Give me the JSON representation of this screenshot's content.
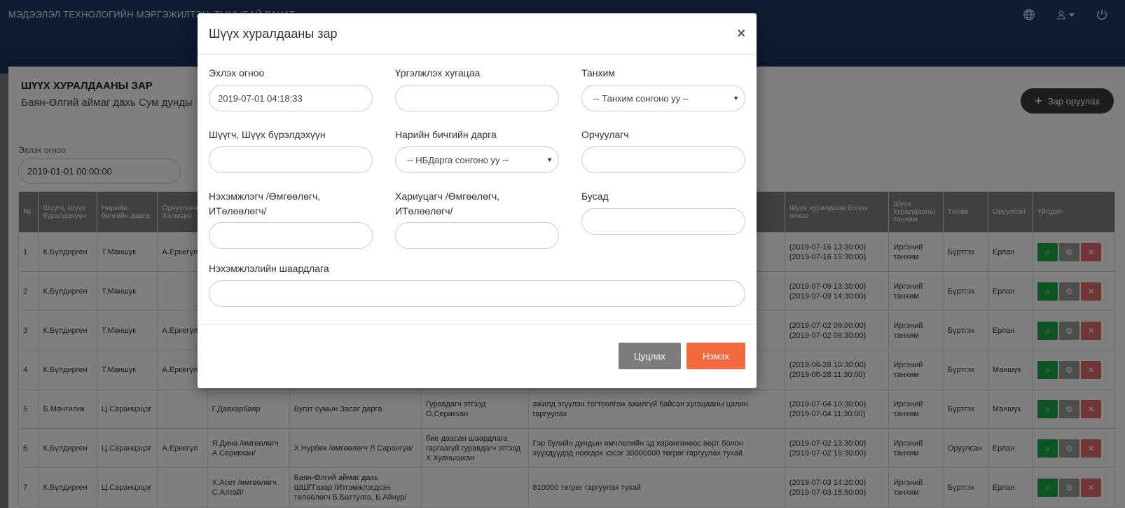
{
  "header": {
    "brand": "МЭДЭЭЛЭЛ ТЕХНОЛОГИЙН МЭРГЭЖИЛТЭН, ТЫНЫБАЙ ВАНАТ",
    "icons": [
      "globe-icon",
      "user-icon",
      "power-icon"
    ]
  },
  "page": {
    "title": "ШҮҮХ ХУРАЛДААНЫ ЗАР",
    "subtitle": "Баян-Өлгий аймаг дахь Сум дунды",
    "add_button": "Зар оруулах",
    "filter_label": "Эхлэх огноо",
    "filter_value": "2019-01-01 00:00:00"
  },
  "table": {
    "headers": [
      "№",
      "Шүүгч, Шүүх бүрэлдэхүүн",
      "Нарийн бичгийн дарга",
      "Орчуулагч Хэлмэрч",
      "",
      "",
      "",
      "",
      "Шүүх хуралдаан болох огноо",
      "Шүүх хуралдааны танхим",
      "Төлөв",
      "Оруулсан",
      "Үйлдэл"
    ],
    "rows": [
      {
        "no": "1",
        "judge": "К.Бүлдирген",
        "secretary": "Т.Маншук",
        "translator": "А.Еркегүл",
        "plaintiff": "",
        "defendant": "",
        "third": "",
        "claim": "",
        "date1": "(2019-07-16 13:30:00)",
        "date2": "(2019-07-16 15:30:00)",
        "hall": "Иргэний танхим",
        "status": "Бүртгэх",
        "added": "Ерлан"
      },
      {
        "no": "2",
        "judge": "К.Бүлдирген",
        "secretary": "Т.Маншук",
        "translator": "",
        "plaintiff": "",
        "defendant": "",
        "third": "",
        "claim": "",
        "date1": "(2019-07-09 13:30:00)",
        "date2": "(2019-07-09 14:30:00)",
        "hall": "Иргэний танхим",
        "status": "Бүртгэх",
        "added": "Ерлан"
      },
      {
        "no": "3",
        "judge": "К.Бүлдирген",
        "secretary": "Т.Маншук",
        "translator": "А.Еркегүл",
        "plaintiff": "",
        "defendant": "",
        "third": "",
        "claim": "",
        "date1": "(2019-07-02 09:00:00)",
        "date2": "(2019-07-02 09:30:00)",
        "hall": "Иргэний танхим",
        "status": "Бүртгэх",
        "added": "Ерлан"
      },
      {
        "no": "4",
        "judge": "К.Бүлдирген",
        "secretary": "Т.Маншук",
        "translator": "А.Еркегүл",
        "plaintiff": "",
        "defendant": "",
        "third": "",
        "claim": "",
        "date1": "(2019-06-28 10:30:00)",
        "date2": "(2019-06-28 11:30:00)",
        "hall": "Иргэний танхим",
        "status": "Бүртгэх",
        "added": "Маншук"
      },
      {
        "no": "5",
        "judge": "Б.Мангилик",
        "secretary": "Ц.Саранцэцэг",
        "translator": "",
        "plaintiff": "Г.Давхарбаяр",
        "defendant": "Бугат сумын Засаг дарга",
        "third": "Гуравдагч этгээд О.Серикхан",
        "claim": "ажилд эгүүлэн тогтоолгож ажилгүй байсан хугацааны цалин гаргуулах",
        "date1": "(2019-07-04 10:30:00)",
        "date2": "(2019-07-04 11:30:00)",
        "hall": "Иргэний танхим",
        "status": "Бүртгэх",
        "added": "Маншук"
      },
      {
        "no": "6",
        "judge": "К.Бүлдирген",
        "secretary": "Ц.Саранцэцэг",
        "translator": "А.Еркегүл",
        "plaintiff": "Я.Дина /өмгөөлөгч А.Серикхан/",
        "defendant": "Х.Нурбек /өмгөөлөгч Л.Сарангуа/",
        "third": "бие даасан шаардлага гаргаагүй гуравдагч этгээд Х.Хуанышхан",
        "claim": "Гэр бүлийн дундын өмчлөлийн эд хөрөнгөнөөс өөрт болон хүүхдүүдэд ноогдох хэсэг 35000000 төгрөг гаргуулах тухай",
        "date1": "(2019-07-02 13:30:00)",
        "date2": "(2019-07-02 15:30:00)",
        "hall": "Иргэний танхим",
        "status": "Оруулсан",
        "added": "Ерлан"
      },
      {
        "no": "7",
        "judge": "К.Бүлдирген",
        "secretary": "Ц.Саранцэцэг",
        "translator": "",
        "plaintiff": "Х.Асет /өмгөөлөгч С.Алтай/",
        "defendant": "Баян-Өлгий аймаг дахь ШШГГазар /Итгэмжлэгдсэн төлөөлөгч Б.Баттулга, Б.Айнур/",
        "third": "",
        "claim": "810000 төгрөг гаргуулах тухай",
        "date1": "(2019-07-03 14:20:00)",
        "date2": "(2019-07-03 15:50:00)",
        "hall": "Иргэний танхим",
        "status": "Бүртгэх",
        "added": "Ерлан"
      }
    ]
  },
  "modal": {
    "title": "Шүүх хуралдааны зар",
    "close": "×",
    "fields": {
      "start_date_label": "Эхлэх огноо",
      "start_date_value": "2019-07-01 04:18:33",
      "duration_label": "Үргэлжлэх хугацаа",
      "duration_value": "",
      "hall_label": "Танхим",
      "hall_value": "-- Танхим сонгоно уу --",
      "judge_label": "Шүүгч, Шүүх бүрэлдэхүүн",
      "judge_value": "",
      "secretary_label": "Нарийн бичгийн дарга",
      "secretary_value": "-- НБДарга сонгоно уу --",
      "translator_label": "Орчуулагч",
      "translator_value": "",
      "plaintiff_label": "Нэхэмжлэгч /Өмгөөлөгч, ИТөлөөлөгч/",
      "plaintiff_value": "",
      "defendant_label": "Хариуцагч /Өмгөөлөгч, ИТөлөөлөгч/",
      "defendant_value": "",
      "other_label": "Бусад",
      "other_value": "",
      "claim_label": "Нэхэмжлэлийн шаардлага",
      "claim_value": ""
    },
    "cancel_button": "Цуцлах",
    "submit_button": "Нэмэх"
  },
  "colors": {
    "header_bg": "#1f3a66",
    "primary_action": "#f26a3d",
    "cancel": "#7d7d7d",
    "view": "#1aa84a",
    "delete": "#e06b6b",
    "status_red": "#d9534f"
  }
}
